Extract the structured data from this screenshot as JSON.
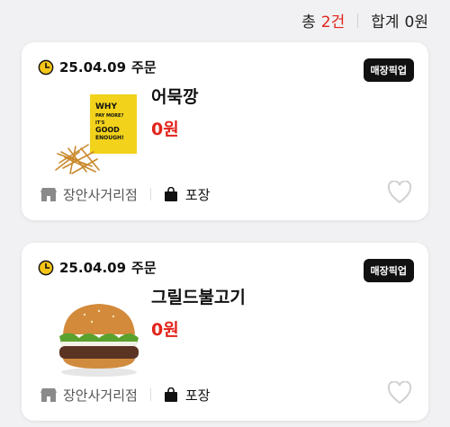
{
  "summary": {
    "count_label": "총",
    "count_value": "2건",
    "total_label": "합계",
    "total_value": "0원"
  },
  "orders": [
    {
      "date": "25.04.09",
      "date_suffix": "주문",
      "badge": "매장픽업",
      "item_name": "어묵깡",
      "price": "0원",
      "store": "장안사거리점",
      "pickup_type": "포장",
      "package_text": [
        "WHY",
        "PAY MORE?",
        "IT'S",
        "GOOD",
        "ENOUGH!"
      ]
    },
    {
      "date": "25.04.09",
      "date_suffix": "주문",
      "badge": "매장픽업",
      "item_name": "그릴드불고기",
      "price": "0원",
      "store": "장안사거리점",
      "pickup_type": "포장"
    }
  ],
  "colors": {
    "accent_red": "#e2231a",
    "badge_bg": "#111111",
    "clock_yellow": "#f5c518"
  },
  "icons": {
    "clock": "clock-icon",
    "store": "store-icon",
    "bag": "shopping-bag-icon",
    "heart": "heart-icon"
  }
}
